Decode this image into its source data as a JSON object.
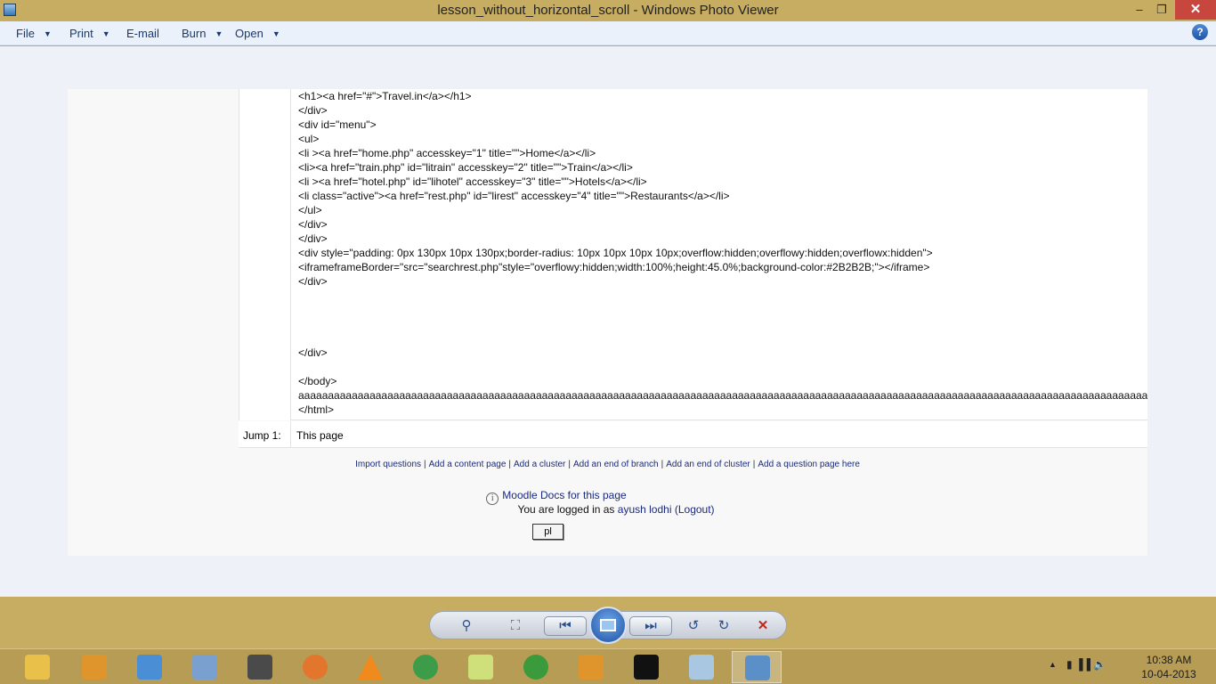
{
  "window": {
    "title": "lesson_without_horizontal_scroll - Windows Photo Viewer",
    "minimize": "–",
    "maximize": "❐",
    "close": "✕"
  },
  "menu": {
    "file": "File",
    "print": "Print",
    "email": "E-mail",
    "burn": "Burn",
    "open": "Open",
    "help": "?"
  },
  "photo": {
    "code_lines": [
      "<h1><a href=\"#\">Travel.in</a></h1>",
      "</div>",
      "<div id=\"menu\">",
      "<ul>",
      "<li ><a href=\"home.php\" accesskey=\"1\" title=\"\">Home</a></li>",
      "<li><a href=\"train.php\" id=\"litrain\" accesskey=\"2\" title=\"\">Train</a></li>",
      "<li ><a href=\"hotel.php\" id=\"lihotel\" accesskey=\"3\" title=\"\">Hotels</a></li>",
      "<li class=\"active\"><a href=\"rest.php\" id=\"lirest\" accesskey=\"4\" title=\"\">Restaurants</a></li>",
      "</ul>",
      "</div>",
      "</div>",
      "<div style=\"padding: 0px 130px 10px 130px;border-radius: 10px 10px 10px 10px;overflow:hidden;overflowy:hidden;overflowx:hidden\">",
      "<iframeframeBorder=\"src=\"searchrest.php\"style=\"overflowy:hidden;width:100%;height:45.0%;background-color:#2B2B2B;\"></iframe>",
      "</div>",
      "",
      "",
      "",
      "",
      "</div>",
      "",
      "</body>",
      "aaaaaaaaaaaaaaaaaaaaaaaaaaaaaaaaaaaaaaaaaaaaaaaaaaaaaaaaaaaaaaaaaaaaaaaaaaaaaaaaaaaaaaaaaaaaaaaaaaaaaaaaaaaaaaaaaaaaaaaaaaaaaaaaaaaaaaaaaaaaaaaaaaaaaaaa",
      "</html>"
    ],
    "jump_label": "Jump 1:",
    "jump_value": "This page",
    "links": [
      "Import questions",
      "Add a content page",
      "Add a cluster",
      "Add an end of branch",
      "Add an end of cluster",
      "Add a question page here"
    ],
    "link_separator": "|",
    "docs_link": "Moodle Docs for this page",
    "info_glyph": "i",
    "login_prefix": "You are logged in as",
    "login_user": "ayush lodhi",
    "logout": "(Logout)",
    "pl_button": "pl"
  },
  "controls": {
    "zoom": "⚲",
    "fit": "⛶",
    "previous": "⏮",
    "next": "⏭",
    "rotate_left": "↺",
    "rotate_right": "↻",
    "delete": "✕"
  },
  "taskbar": {
    "apps": [
      {
        "name": "file-explorer",
        "color": "#e8c04a"
      },
      {
        "name": "folder-window",
        "color": "#e0952c"
      },
      {
        "name": "control-panel",
        "color": "#4a8fd6"
      },
      {
        "name": "virtualbox",
        "color": "#7aa0d0"
      },
      {
        "name": "sublime-text",
        "color": "#4a4a4a"
      },
      {
        "name": "firefox",
        "color": "#e2762c"
      },
      {
        "name": "vlc",
        "color": "#f08a1c"
      },
      {
        "name": "chrome",
        "color": "#3c9c4a"
      },
      {
        "name": "sticky-notes",
        "color": "#cfe07a"
      },
      {
        "name": "utorrent",
        "color": "#3a9a3c"
      },
      {
        "name": "file-manager",
        "color": "#e0952c"
      },
      {
        "name": "command-prompt",
        "color": "#111111"
      },
      {
        "name": "notepad",
        "color": "#a9c7e0"
      },
      {
        "name": "photo-viewer",
        "color": "#5b8fc8"
      }
    ],
    "tray_expand": "▲",
    "tray_icons": "▮  ▐▐  🔈",
    "time": "10:38 AM",
    "date": "10-04-2013"
  }
}
